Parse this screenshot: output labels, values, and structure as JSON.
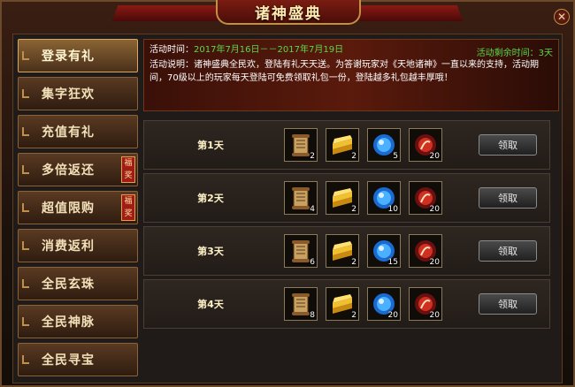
{
  "window": {
    "title": "诸神盛典",
    "close_label": "✕"
  },
  "sidebar": {
    "items": [
      {
        "label": "登录有礼",
        "tag": ""
      },
      {
        "label": "集字狂欢",
        "tag": ""
      },
      {
        "label": "充值有礼",
        "tag": ""
      },
      {
        "label": "多倍返还",
        "tag": "福奖"
      },
      {
        "label": "超值限购",
        "tag": "福奖"
      },
      {
        "label": "消费返利",
        "tag": ""
      },
      {
        "label": "全民玄珠",
        "tag": ""
      },
      {
        "label": "全民神脉",
        "tag": ""
      },
      {
        "label": "全民寻宝",
        "tag": ""
      }
    ]
  },
  "banner": {
    "time_label": "活动时间：",
    "time_value": "2017年7月16日－－2017年7月19日",
    "remaining": "活动剩余时间：3天",
    "desc_label": "活动说明：",
    "desc_text": "诸神盛典全民欢，登陆有礼天天送。为答谢玩家对《天地诸神》一直以来的支持，活动期间，70级以上的玩家每天登陆可免费领取礼包一份，登陆越多礼包越丰厚哦！"
  },
  "days": [
    {
      "label": "第1天",
      "counts": [
        "2",
        "2",
        "5",
        "20"
      ],
      "button": "领取"
    },
    {
      "label": "第2天",
      "counts": [
        "4",
        "2",
        "10",
        "20"
      ],
      "button": "领取"
    },
    {
      "label": "第3天",
      "counts": [
        "6",
        "2",
        "15",
        "20"
      ],
      "button": "领取"
    },
    {
      "label": "第4天",
      "counts": [
        "8",
        "2",
        "20",
        "20"
      ],
      "button": "领取"
    }
  ],
  "item_icons": [
    "scroll-icon",
    "gold-ingot-icon",
    "blue-orb-icon",
    "red-orb-icon"
  ],
  "colors": {
    "accent_green": "#5cd84a",
    "frame_gold": "#c09048",
    "tag_red": "#a01c14"
  }
}
